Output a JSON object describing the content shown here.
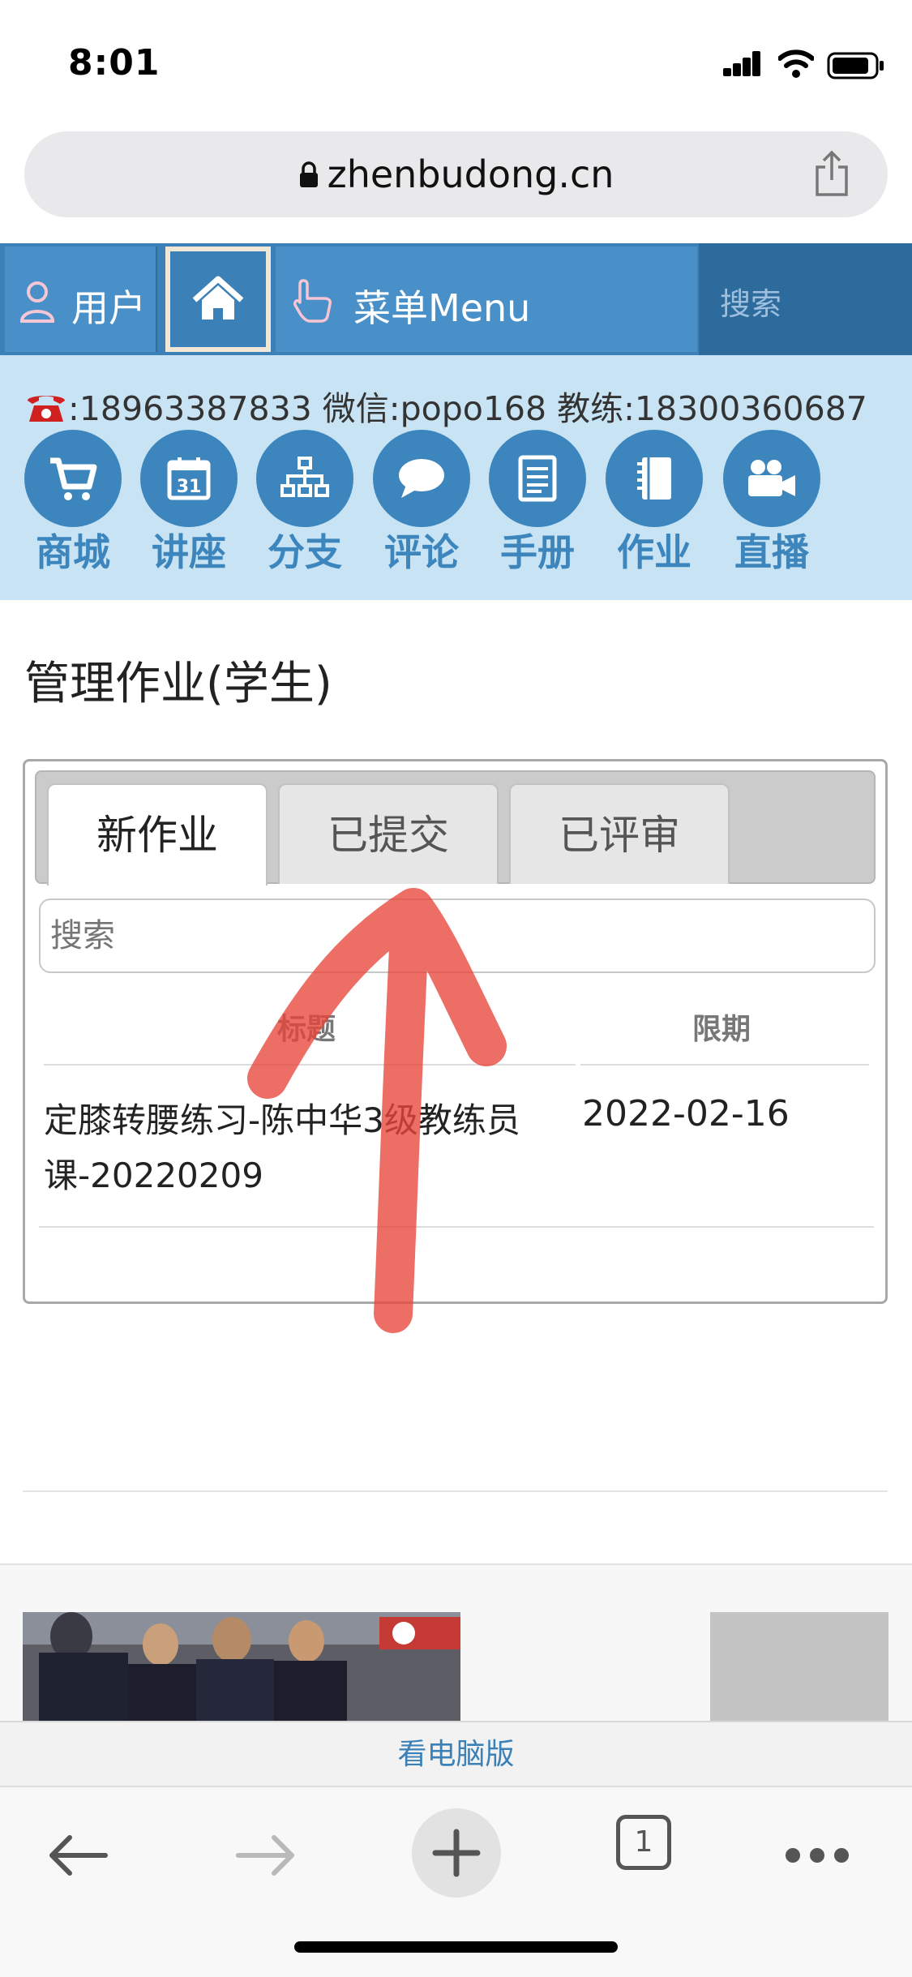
{
  "status_bar": {
    "time": "8:01"
  },
  "browser": {
    "url": "zhenbudong.cn",
    "tab_count": "1"
  },
  "site_nav": {
    "user_label": "用户",
    "menu_label": "菜单Menu",
    "search_placeholder": "搜索"
  },
  "contact": {
    "text": ":18963387833 微信:popo168 教练:18300360687"
  },
  "categories": [
    {
      "label": "商城",
      "icon": "cart-icon"
    },
    {
      "label": "讲座",
      "icon": "calendar-icon"
    },
    {
      "label": "分支",
      "icon": "sitemap-icon"
    },
    {
      "label": "评论",
      "icon": "comment-icon"
    },
    {
      "label": "手册",
      "icon": "document-icon"
    },
    {
      "label": "作业",
      "icon": "notebook-icon"
    },
    {
      "label": "直播",
      "icon": "video-camera-icon"
    }
  ],
  "page": {
    "title": "管理作业(学生)"
  },
  "tabs": [
    {
      "label": "新作业",
      "active": true
    },
    {
      "label": "已提交",
      "active": false
    },
    {
      "label": "已评审",
      "active": false
    }
  ],
  "search": {
    "placeholder": "搜索"
  },
  "table": {
    "columns": [
      "标题",
      "限期"
    ],
    "rows": [
      {
        "title": "定膝转腰练习-陈中华3级教练员课-20220209",
        "deadline": "2022-02-16"
      }
    ]
  },
  "footer": {
    "desktop_link": "看电脑版"
  },
  "colors": {
    "nav_blue": "#3b81b8",
    "info_band": "#c8e3f3",
    "annotation_arrow": "#e8463a"
  }
}
